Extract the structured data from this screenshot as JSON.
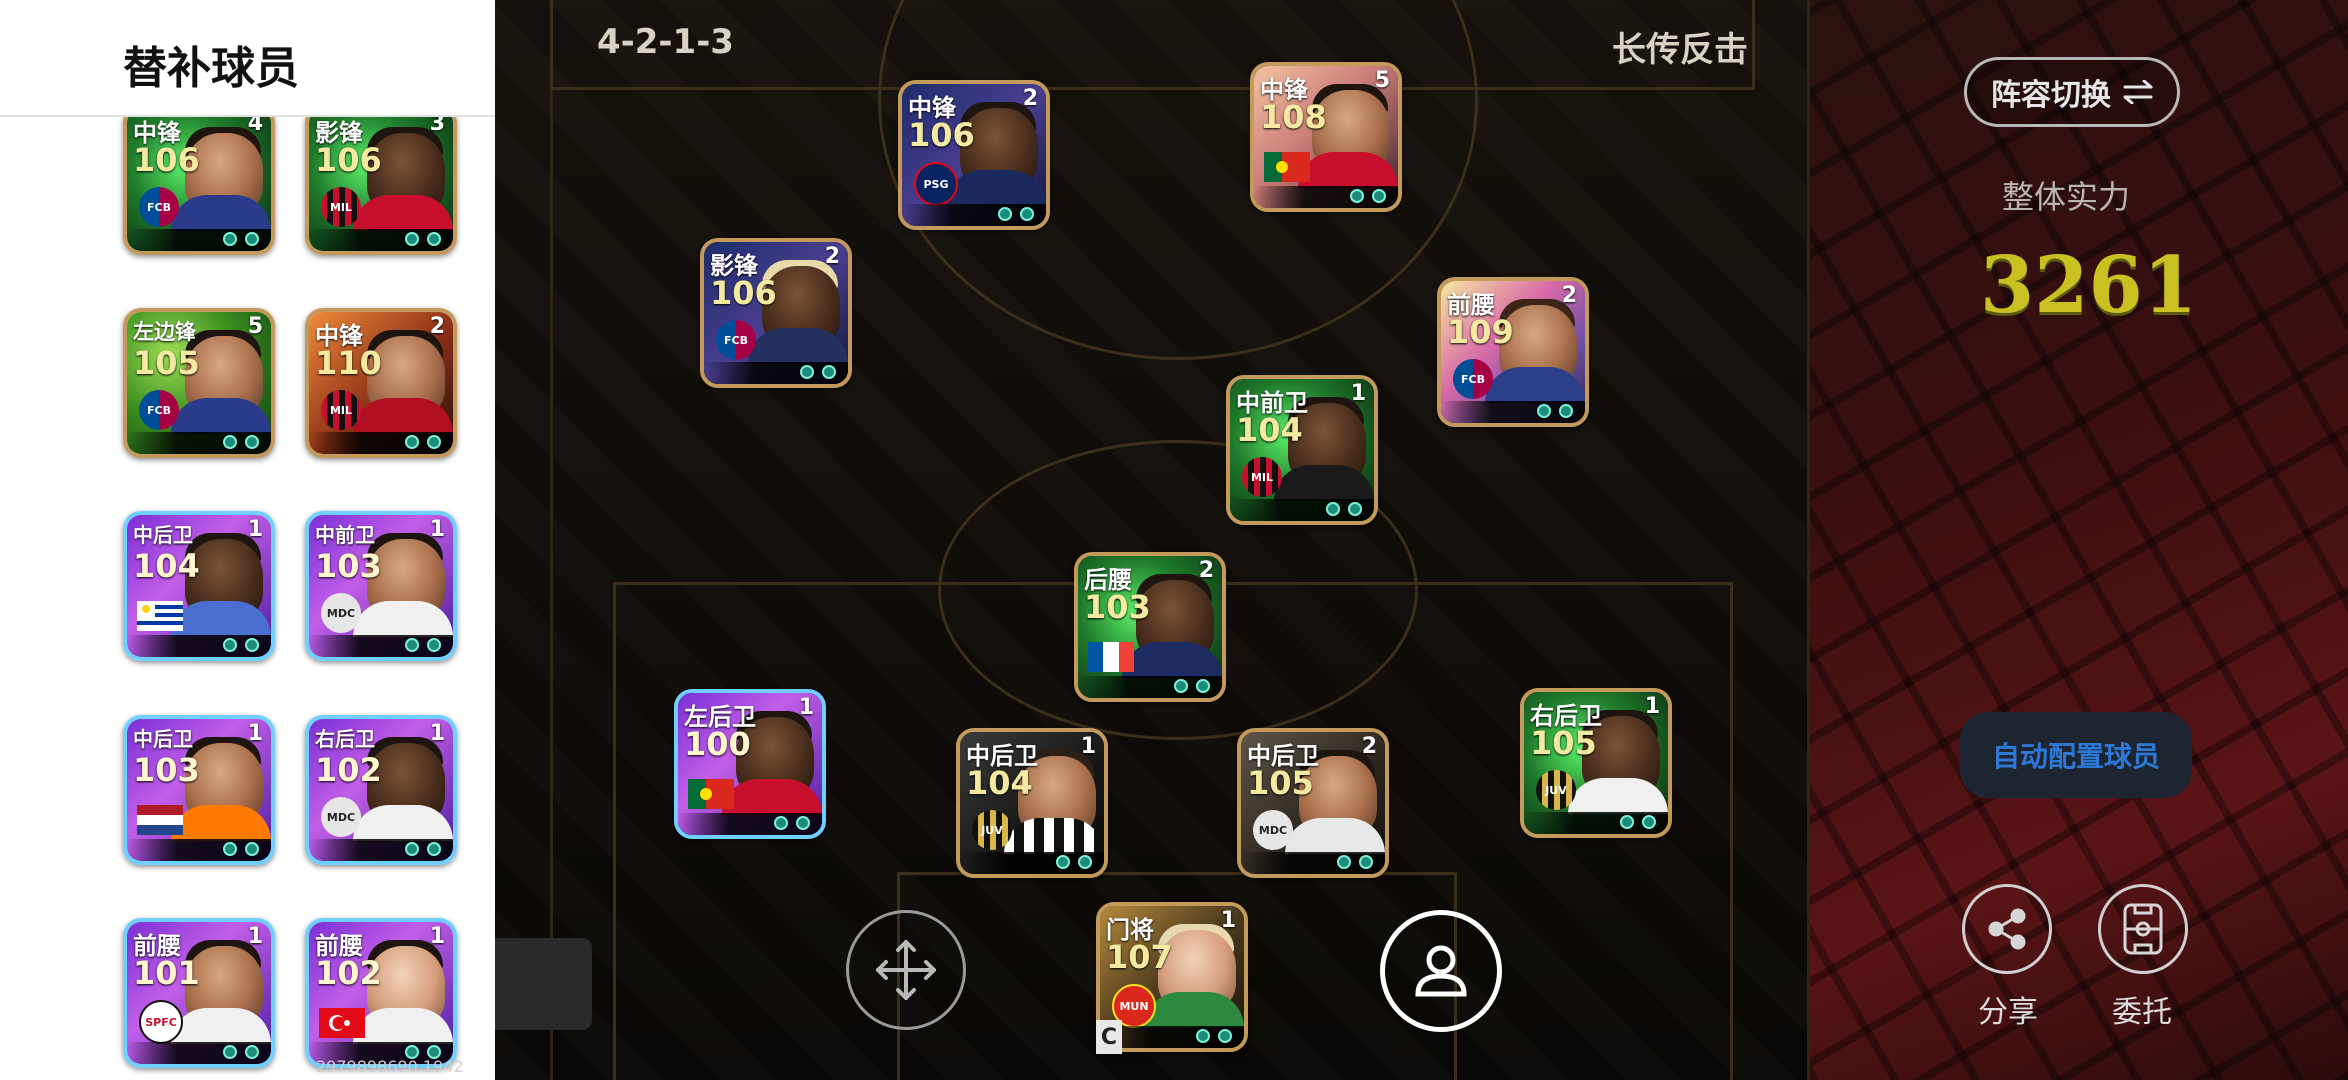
{
  "sub_panel": {
    "title": "替补球员",
    "cards": [
      {
        "position": "中锋",
        "rating": "106",
        "level": "4",
        "badge": "FCB",
        "badge_color": "#a50044"
      },
      {
        "position": "影锋",
        "rating": "106",
        "level": "3",
        "badge": "MIL",
        "badge_color": "#c8102e"
      },
      {
        "position": "左边锋",
        "rating": "105",
        "level": "5",
        "badge": "FCB",
        "badge_color": "#a50044"
      },
      {
        "position": "中锋",
        "rating": "110",
        "level": "2",
        "badge": "MIL",
        "badge_color": "#c8102e"
      },
      {
        "position": "中后卫",
        "rating": "104",
        "level": "1",
        "badge": "URU",
        "badge_color": "#7ab3e6"
      },
      {
        "position": "中前卫",
        "rating": "103",
        "level": "1",
        "badge": "MDC",
        "badge_color": "#dddddd"
      },
      {
        "position": "中后卫",
        "rating": "103",
        "level": "1",
        "badge": "NED",
        "badge_color": "#ae1c28"
      },
      {
        "position": "右后卫",
        "rating": "102",
        "level": "1",
        "badge": "MDC",
        "badge_color": "#dddddd"
      },
      {
        "position": "前腰",
        "rating": "101",
        "level": "1",
        "badge": "SPFC",
        "badge_color": "#ffffff"
      },
      {
        "position": "前腰",
        "rating": "102",
        "level": "1",
        "badge": "TUR",
        "badge_color": "#e30a17"
      }
    ]
  },
  "pitch": {
    "formation": "4-2-1-3",
    "tactic": "长传反击",
    "players": [
      {
        "position": "中锋",
        "rating": "106",
        "level": "2",
        "badge": "PSG"
      },
      {
        "position": "中锋",
        "rating": "108",
        "level": "5",
        "badge": "POR"
      },
      {
        "position": "影锋",
        "rating": "106",
        "level": "2",
        "badge": "FCB"
      },
      {
        "position": "前腰",
        "rating": "109",
        "level": "2",
        "badge": "FCB"
      },
      {
        "position": "中前卫",
        "rating": "104",
        "level": "1",
        "badge": "MIL"
      },
      {
        "position": "后腰",
        "rating": "103",
        "level": "2",
        "badge": "FRA"
      },
      {
        "position": "左后卫",
        "rating": "100",
        "level": "1",
        "badge": "POR"
      },
      {
        "position": "中后卫",
        "rating": "104",
        "level": "1",
        "badge": "JUV"
      },
      {
        "position": "中后卫",
        "rating": "105",
        "level": "2",
        "badge": "MDC"
      },
      {
        "position": "右后卫",
        "rating": "105",
        "level": "1",
        "badge": "JUV"
      },
      {
        "position": "门将",
        "rating": "107",
        "level": "1",
        "badge": "MUN"
      }
    ],
    "captain_mark": "C"
  },
  "right_panel": {
    "switch_label": "阵容切换",
    "strength_label": "整体实力",
    "strength_value": "3261",
    "auto_button": "自动配置球员",
    "share_label": "分享",
    "delegate_label": "委托"
  },
  "footer": {
    "id_text": "2979898690   1942"
  },
  "colors": {
    "panel_bg": "#ffffff",
    "strength_yellow": "#c9c021",
    "auto_text_blue": "#2d78d6",
    "card_gold_border": "#c39a5c",
    "card_purple_border": "#6fd0ff"
  }
}
